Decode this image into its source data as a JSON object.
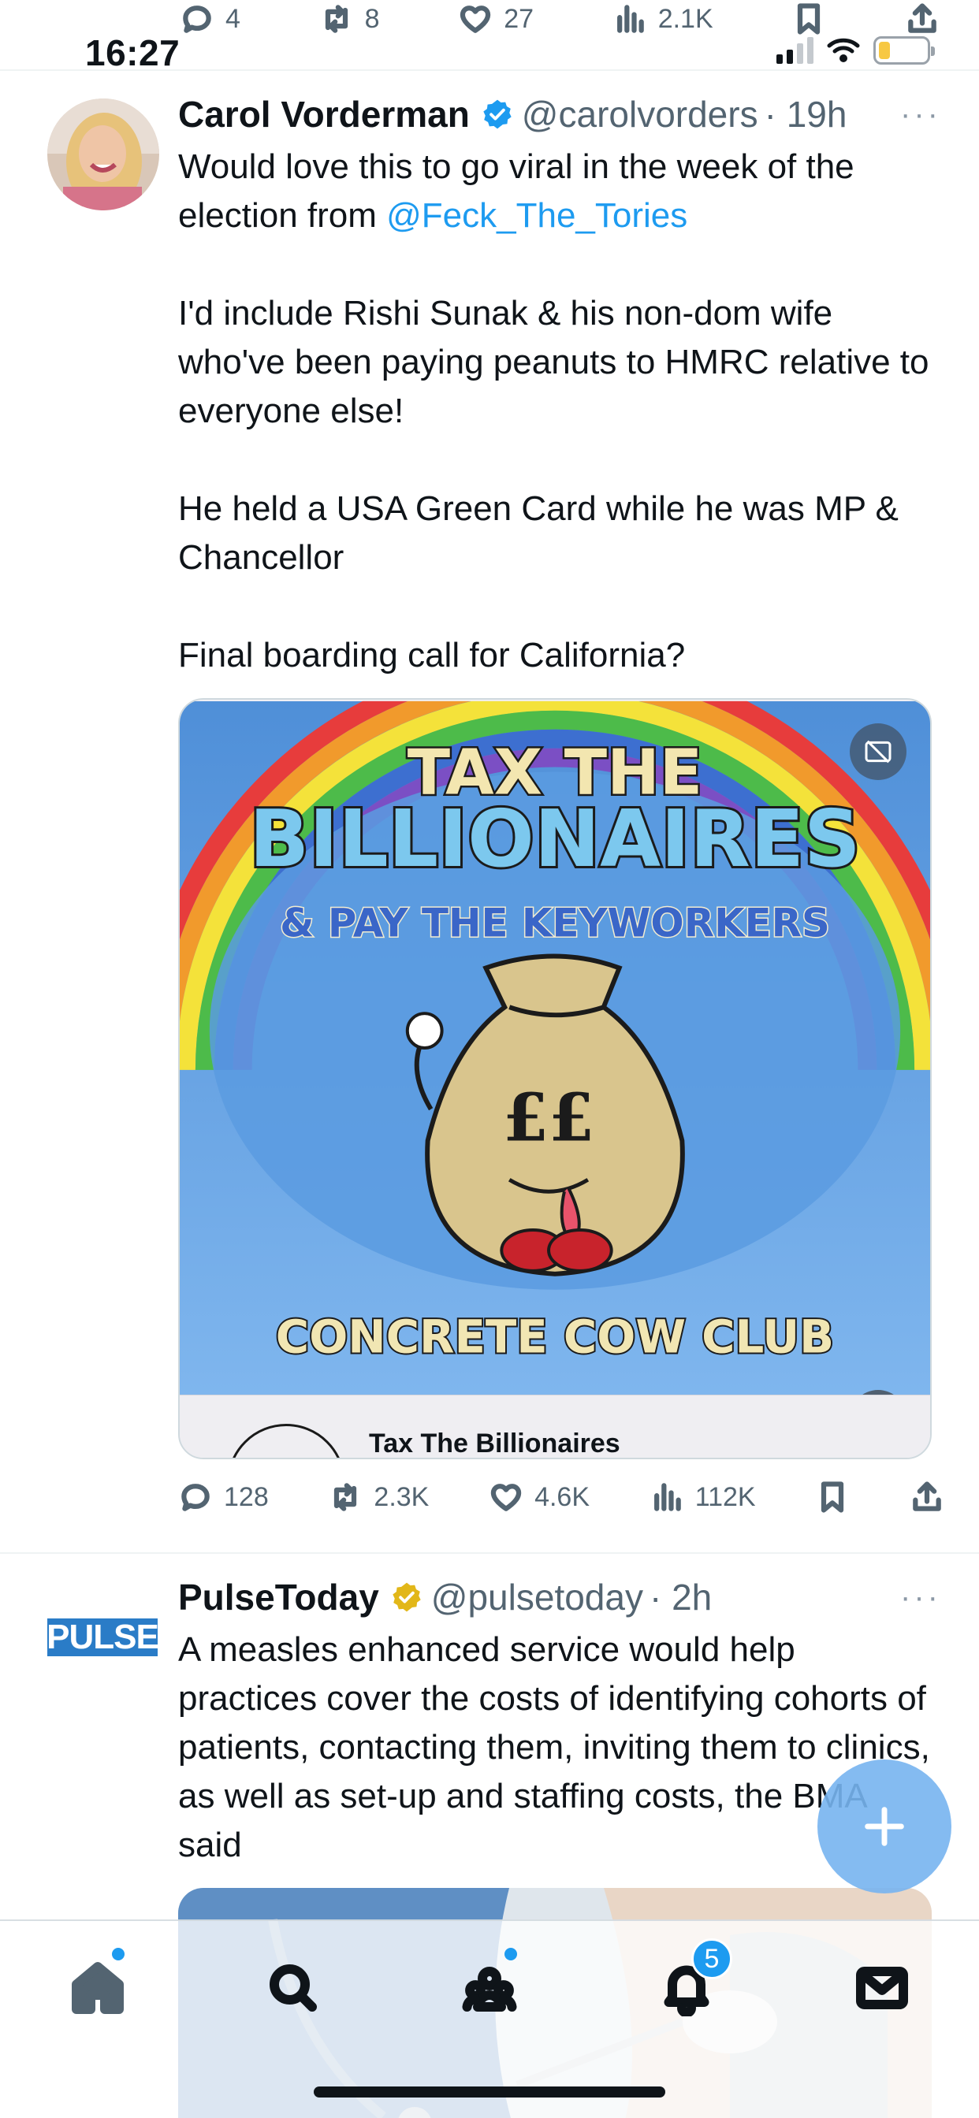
{
  "top_bar": {
    "replies": "4",
    "retweets": "8",
    "likes": "27",
    "views": "2.1K"
  },
  "status": {
    "time": "16:27"
  },
  "tweets": [
    {
      "name": "Carol Vorderman",
      "handle": "@carolvorders",
      "time": "· 19h",
      "more": "···",
      "text_intro": "Would love this to go viral in the week of the election from ",
      "mention": "@Feck_The_Tories",
      "text_rest": "\n\nI'd include Rishi Sunak & his non-dom wife who've been paying peanuts to HMRC relative to everyone else!\n\nHe held a USA Green Card while he was MP & Chancellor\n\nFinal boarding call for California?",
      "media": {
        "line1": "TAX THE",
        "line2": "BILLIONAIRES",
        "line3": "& PAY THE KEYWORKERS",
        "bag_text": "££",
        "club": "CONCRETE COW CLUB",
        "card_title": "Tax The Billionaires"
      },
      "stats": {
        "replies": "128",
        "retweets": "2.3K",
        "likes": "4.6K",
        "views": "112K"
      }
    },
    {
      "name": "PulseToday",
      "handle": "@pulsetoday",
      "time": "· 2h",
      "more": "···",
      "logo": "PULSE",
      "text": "A measles enhanced service would help practices cover the costs of identifying cohorts of patients, contacting them, inviting them to clinics, as well as set-up and staffing costs, the BMA said"
    }
  ],
  "tabbar": {
    "notifications_count": "5"
  },
  "colors": {
    "accent": "#1d9bf0",
    "verified_blue": "#1d9bf0",
    "verified_gold": "#e2b719"
  }
}
